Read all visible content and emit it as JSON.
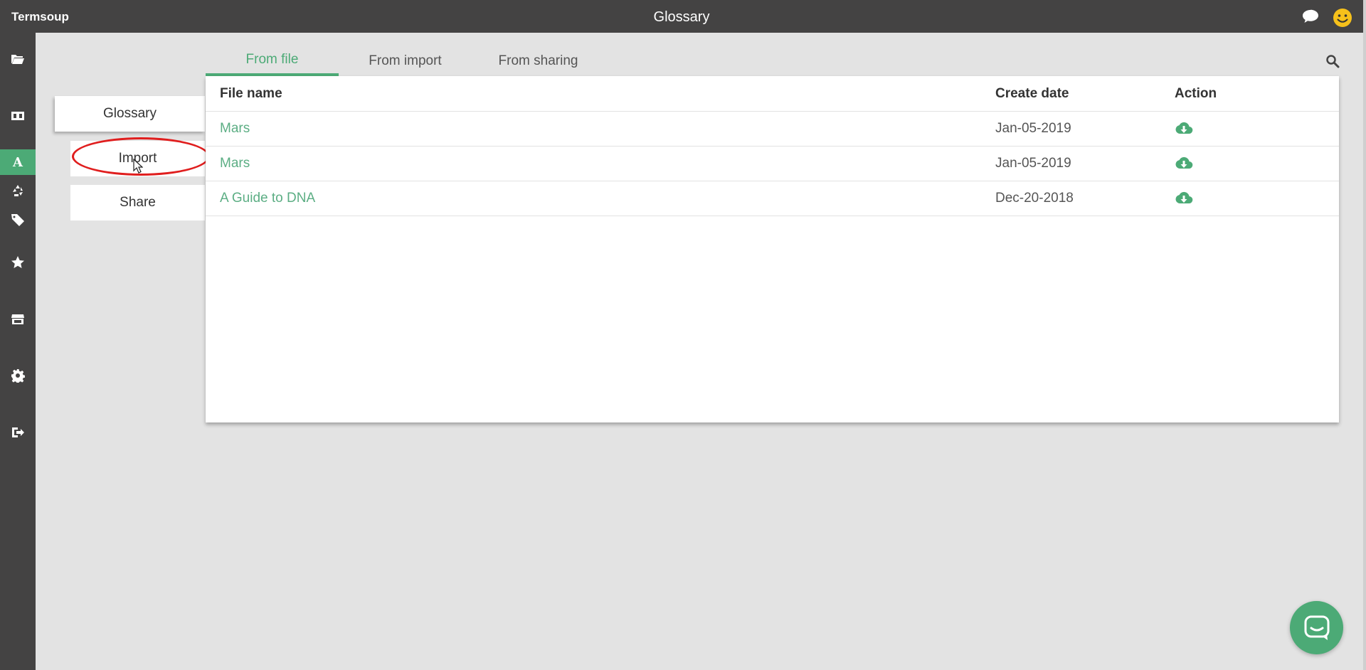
{
  "topbar": {
    "brand": "Termsoup",
    "title": "Glossary",
    "chat_icon": "chat-icon",
    "user_icon": "smiley-icon"
  },
  "sidebar": {
    "items": [
      {
        "icon": "folder-open-icon"
      },
      {
        "icon": "translate-icon"
      },
      {
        "icon": "glossary-icon",
        "label": "A",
        "active": true
      },
      {
        "icon": "recycle-icon"
      },
      {
        "icon": "tag-icon"
      },
      {
        "icon": "star-icon"
      },
      {
        "icon": "store-icon"
      },
      {
        "icon": "gear-icon"
      },
      {
        "icon": "sign-out-icon"
      }
    ]
  },
  "subnav": {
    "items": [
      "Glossary",
      "Import",
      "Share"
    ]
  },
  "tabs": [
    {
      "label": "From file",
      "active": true
    },
    {
      "label": "From import",
      "active": false
    },
    {
      "label": "From sharing",
      "active": false
    }
  ],
  "table": {
    "headers": [
      "File name",
      "Create date",
      "Action"
    ],
    "rows": [
      {
        "name": "Mars",
        "date": "Jan-05-2019"
      },
      {
        "name": "Mars",
        "date": "Jan-05-2019"
      },
      {
        "name": "A Guide to DNA",
        "date": "Dec-20-2018"
      }
    ]
  },
  "colors": {
    "accent": "#4caa76",
    "dark": "#444343",
    "highlight": "#e01e1e"
  }
}
